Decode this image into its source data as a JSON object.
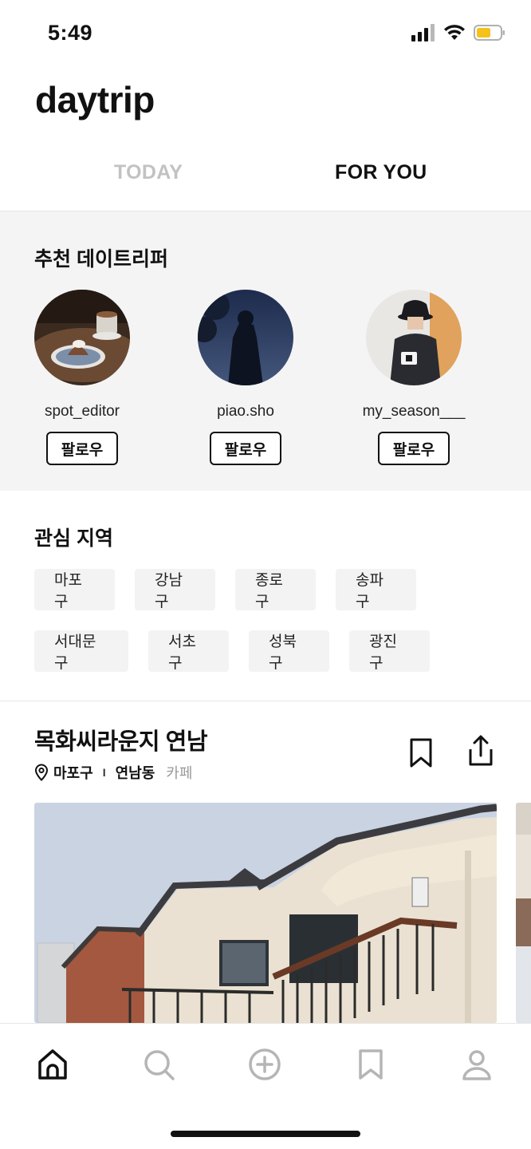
{
  "status_bar": {
    "time": "5:49"
  },
  "header": {
    "app_title": "daytrip"
  },
  "tabs": [
    {
      "label": "TODAY",
      "active": false
    },
    {
      "label": "FOR YOU",
      "active": true
    }
  ],
  "recommended": {
    "title": "추천 데이트리퍼",
    "users": [
      {
        "username": "spot_editor",
        "follow_label": "팔로우"
      },
      {
        "username": "piao.sho",
        "follow_label": "팔로우"
      },
      {
        "username": "my_season___",
        "follow_label": "팔로우"
      }
    ]
  },
  "regions": {
    "title": "관심 지역",
    "row1": [
      "마포구",
      "강남구",
      "종로구",
      "송파구"
    ],
    "row2": [
      "서대문구",
      "서초구",
      "성북구",
      "광진구"
    ]
  },
  "place": {
    "name": "목화씨라운지 연남",
    "district": "마포구",
    "separator": "I",
    "neighborhood": "연남동",
    "category": "카페"
  },
  "bottom_nav": {
    "items": [
      {
        "icon": "home-icon",
        "active": true
      },
      {
        "icon": "search-icon",
        "active": false
      },
      {
        "icon": "add-circle-icon",
        "active": false
      },
      {
        "icon": "bookmark-icon",
        "active": false
      },
      {
        "icon": "profile-icon",
        "active": false
      }
    ]
  },
  "colors": {
    "accent": "#111111",
    "inactive_tab": "#c2c2c2",
    "section_bg": "#f4f4f4",
    "chip_bg": "#f3f3f3",
    "nav_inactive": "#b5b5b5",
    "battery": "#f4c21a"
  }
}
